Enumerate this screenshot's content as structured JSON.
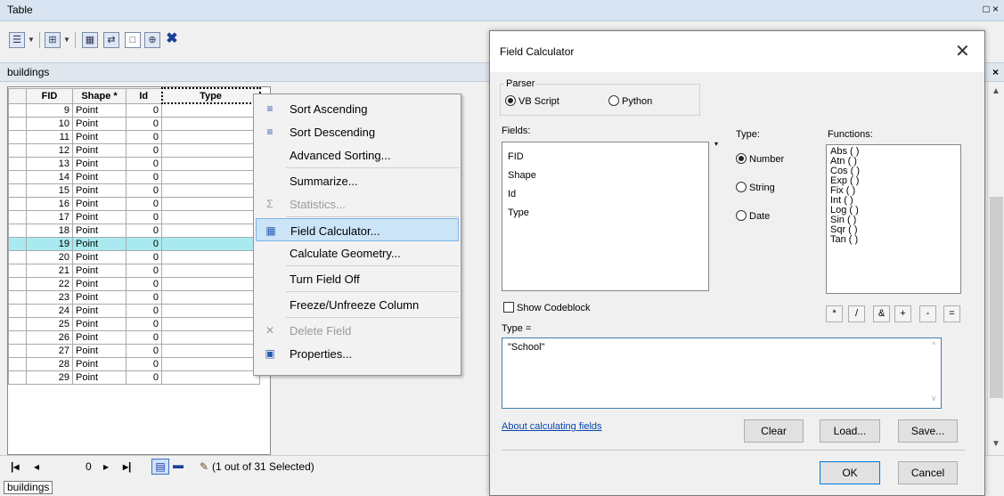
{
  "window": {
    "title": "Table",
    "controls": "□ ×"
  },
  "toolbar": {
    "icons": [
      "table-options-icon",
      "related-tables-icon",
      "select-by-attributes-icon",
      "switch-selection-icon",
      "clear-selection-icon",
      "zoom-to-selected-icon",
      "delete-selected-icon"
    ]
  },
  "tab": {
    "name": "buildings",
    "close": "×"
  },
  "grid": {
    "columns": [
      "FID",
      "Shape *",
      "Id",
      "Type"
    ],
    "rows": [
      {
        "fid": "9",
        "shape": "Point",
        "id": "0"
      },
      {
        "fid": "10",
        "shape": "Point",
        "id": "0"
      },
      {
        "fid": "11",
        "shape": "Point",
        "id": "0"
      },
      {
        "fid": "12",
        "shape": "Point",
        "id": "0"
      },
      {
        "fid": "13",
        "shape": "Point",
        "id": "0"
      },
      {
        "fid": "14",
        "shape": "Point",
        "id": "0"
      },
      {
        "fid": "15",
        "shape": "Point",
        "id": "0"
      },
      {
        "fid": "16",
        "shape": "Point",
        "id": "0"
      },
      {
        "fid": "17",
        "shape": "Point",
        "id": "0"
      },
      {
        "fid": "18",
        "shape": "Point",
        "id": "0"
      },
      {
        "fid": "19",
        "shape": "Point",
        "id": "0",
        "selected": true
      },
      {
        "fid": "20",
        "shape": "Point",
        "id": "0"
      },
      {
        "fid": "21",
        "shape": "Point",
        "id": "0"
      },
      {
        "fid": "22",
        "shape": "Point",
        "id": "0"
      },
      {
        "fid": "23",
        "shape": "Point",
        "id": "0"
      },
      {
        "fid": "24",
        "shape": "Point",
        "id": "0"
      },
      {
        "fid": "25",
        "shape": "Point",
        "id": "0"
      },
      {
        "fid": "26",
        "shape": "Point",
        "id": "0"
      },
      {
        "fid": "27",
        "shape": "Point",
        "id": "0"
      },
      {
        "fid": "28",
        "shape": "Point",
        "id": "0"
      },
      {
        "fid": "29",
        "shape": "Point",
        "id": "0"
      }
    ],
    "selected_color": "#a8eaf0"
  },
  "context_menu": {
    "items": [
      {
        "label": "Sort Ascending",
        "icon": "sort-ascending-icon",
        "enabled": true
      },
      {
        "label": "Sort Descending",
        "icon": "sort-descending-icon",
        "enabled": true
      },
      {
        "label": "Advanced Sorting...",
        "icon": "",
        "enabled": true
      },
      {
        "label": "Summarize...",
        "icon": "",
        "enabled": true
      },
      {
        "label": "Statistics...",
        "icon": "sigma-icon",
        "enabled": false
      },
      {
        "label": "Field Calculator...",
        "icon": "calculator-icon",
        "enabled": true,
        "hover": true
      },
      {
        "label": "Calculate Geometry...",
        "icon": "",
        "enabled": true
      },
      {
        "label": "Turn Field Off",
        "icon": "",
        "enabled": true
      },
      {
        "label": "Freeze/Unfreeze Column",
        "icon": "",
        "enabled": true
      },
      {
        "label": "Delete Field",
        "icon": "delete-icon",
        "enabled": false
      },
      {
        "label": "Properties...",
        "icon": "properties-icon",
        "enabled": true
      }
    ]
  },
  "status": {
    "record_value": "0",
    "selection_text": "(1 out of 31 Selected)"
  },
  "bottom_tab": "buildings",
  "dialog": {
    "title": "Field Calculator",
    "parser": {
      "legend": "Parser",
      "options": [
        "VB Script",
        "Python"
      ],
      "selected": "VB Script"
    },
    "fields_label": "Fields:",
    "fields": [
      "FID",
      "Shape",
      "Id",
      "Type"
    ],
    "type_label": "Type:",
    "types": [
      "Number",
      "String",
      "Date"
    ],
    "type_selected": "Number",
    "functions_label": "Functions:",
    "functions": [
      "Abs ( )",
      "Atn ( )",
      "Cos ( )",
      "Exp ( )",
      "Fix ( )",
      "Int ( )",
      "Log ( )",
      "Sin ( )",
      "Sqr ( )",
      "Tan ( )"
    ],
    "show_codeblock": "Show Codeblock",
    "operators": [
      "*",
      "/",
      "&",
      "+",
      "-",
      "="
    ],
    "expression_label": "Type =",
    "expression": "\"School\"",
    "about_link": "About calculating fields",
    "buttons": {
      "clear": "Clear",
      "load": "Load...",
      "save": "Save...",
      "ok": "OK",
      "cancel": "Cancel"
    }
  }
}
